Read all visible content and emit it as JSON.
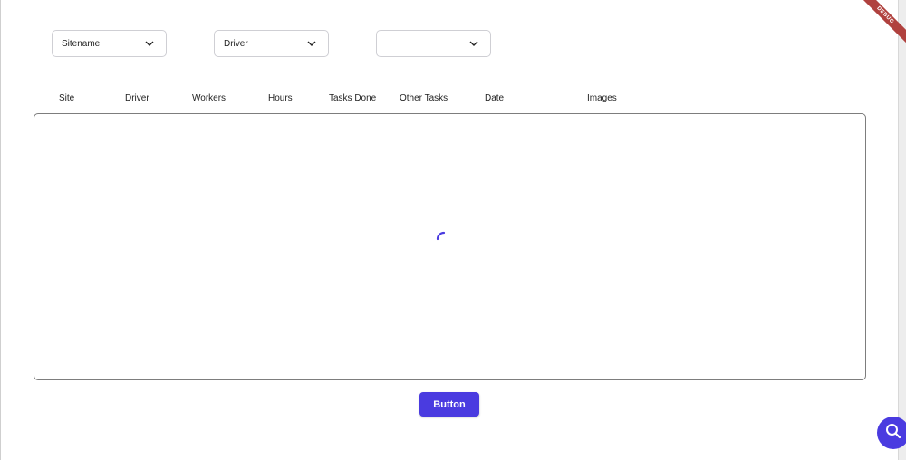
{
  "filters": {
    "sitename": {
      "value": "Sitename"
    },
    "driver": {
      "value": "Driver"
    },
    "third": {
      "value": ""
    }
  },
  "table": {
    "columns": [
      "Site",
      "Driver",
      "Workers",
      "Hours",
      "Tasks Done",
      "Other Tasks",
      "Date",
      "Images"
    ]
  },
  "actions": {
    "button_label": "Button"
  },
  "debug_banner": "DEBUG",
  "colors": {
    "accent": "#4a3be0",
    "debug_banner": "#b0413e"
  }
}
